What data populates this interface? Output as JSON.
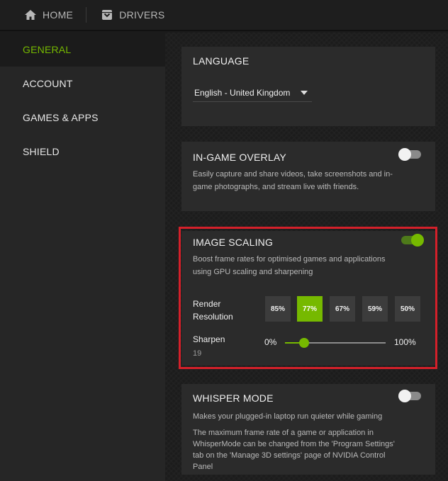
{
  "topbar": {
    "home_label": "HOME",
    "drivers_label": "DRIVERS"
  },
  "sidebar": {
    "items": [
      {
        "label": "GENERAL",
        "active": true
      },
      {
        "label": "ACCOUNT",
        "active": false
      },
      {
        "label": "GAMES & APPS",
        "active": false
      },
      {
        "label": "SHIELD",
        "active": false
      }
    ]
  },
  "language": {
    "title": "LANGUAGE",
    "selected": "English - United Kingdom"
  },
  "overlay": {
    "title": "IN-GAME OVERLAY",
    "description": "Easily capture and share videos, take screenshots and in-game photographs, and stream live with friends.",
    "enabled": false
  },
  "image_scaling": {
    "title": "IMAGE SCALING",
    "description": "Boost frame rates for optimised games and applications using GPU scaling and sharpening",
    "enabled": true,
    "render_resolution_label": "Render Resolution",
    "resolutions": [
      "85%",
      "77%",
      "67%",
      "59%",
      "50%"
    ],
    "selected_resolution": "77%",
    "sharpen_label": "Sharpen",
    "sharpen_value": "19",
    "slider_min_label": "0%",
    "slider_max_label": "100%",
    "sharpen_level": 0.19
  },
  "whisper": {
    "title": "WHISPER MODE",
    "description": "Makes your plugged-in laptop run quieter while gaming",
    "description2": "The maximum frame rate of a game or application in WhisperMode can be changed from the 'Program Settings' tab on the 'Manage 3D settings' page of NVIDIA Control Panel",
    "enabled": false
  },
  "colors": {
    "accent": "#76b900",
    "highlight_border": "#d4202a"
  },
  "icons": {
    "home": "home-icon",
    "drivers": "drivers-icon",
    "dropdown": "chevron-down-icon"
  }
}
